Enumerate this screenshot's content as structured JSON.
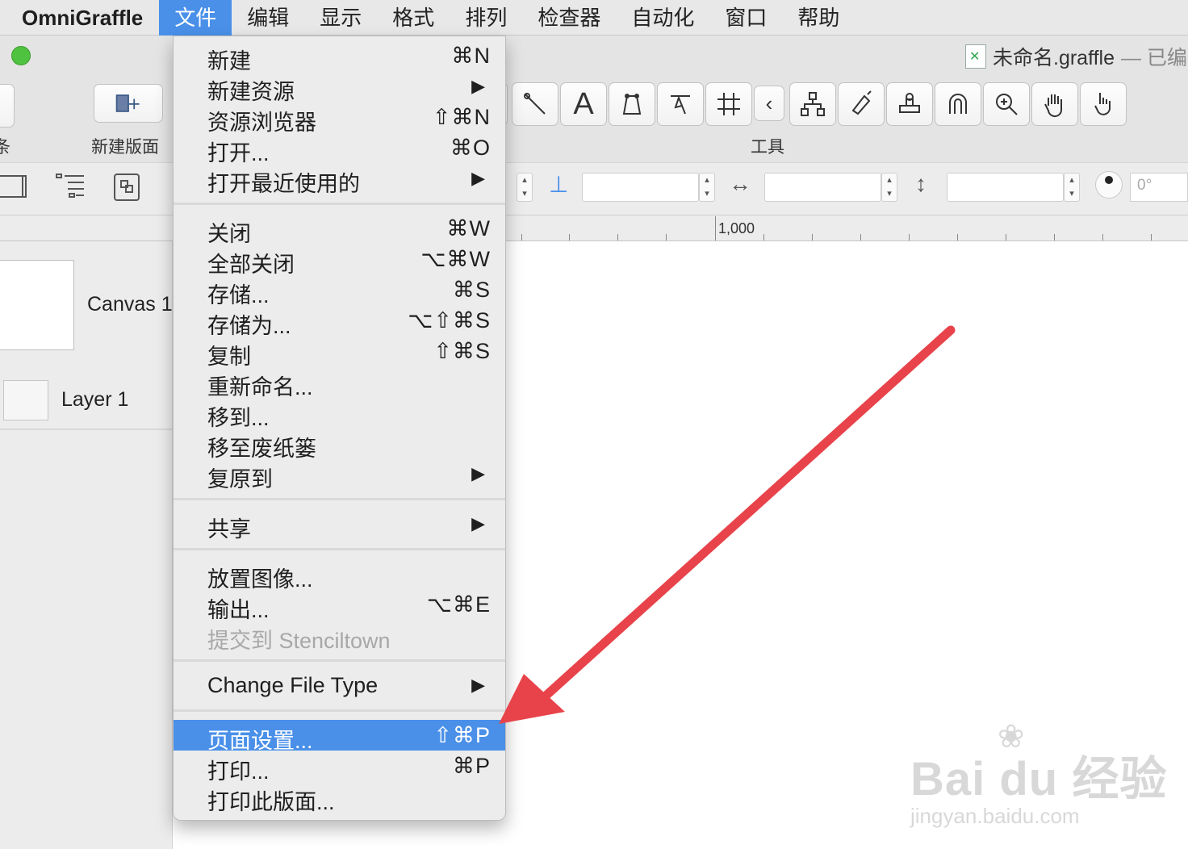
{
  "menubar": {
    "app_name": "OmniGraffle",
    "items": [
      "文件",
      "编辑",
      "显示",
      "格式",
      "排列",
      "检查器",
      "自动化",
      "窗口",
      "帮助"
    ]
  },
  "window": {
    "title": "未命名.graffle",
    "title_suffix": "— 已编",
    "toolbar": {
      "left_partial_label": "条",
      "new_canvas_label": "新建版面",
      "tools_label": "工具"
    },
    "inspector": {
      "angle_value": "0°"
    },
    "ruler": {
      "label": "1,000"
    },
    "sidebar": {
      "canvas_name": "Canvas 1",
      "layer_name": "Layer 1"
    }
  },
  "file_menu": {
    "groups": [
      [
        {
          "label": "新建",
          "shortcut": "⌘N"
        },
        {
          "label": "新建资源",
          "submenu": true
        },
        {
          "label": "资源浏览器",
          "shortcut": "⇧⌘N"
        },
        {
          "label": "打开...",
          "shortcut": "⌘O"
        },
        {
          "label": "打开最近使用的",
          "submenu": true
        }
      ],
      [
        {
          "label": "关闭",
          "shortcut": "⌘W"
        },
        {
          "label": "全部关闭",
          "shortcut": "⌥⌘W"
        },
        {
          "label": "存储...",
          "shortcut": "⌘S"
        },
        {
          "label": "存储为...",
          "shortcut": "⌥⇧⌘S"
        },
        {
          "label": "复制",
          "shortcut": "⇧⌘S"
        },
        {
          "label": "重新命名..."
        },
        {
          "label": "移到..."
        },
        {
          "label": "移至废纸篓"
        },
        {
          "label": "复原到",
          "submenu": true
        }
      ],
      [
        {
          "label": "共享",
          "submenu": true
        }
      ],
      [
        {
          "label": "放置图像..."
        },
        {
          "label": "输出...",
          "shortcut": "⌥⌘E"
        },
        {
          "label": "提交到 Stenciltown",
          "disabled": true
        }
      ],
      [
        {
          "label": "Change File Type",
          "submenu": true
        }
      ],
      [
        {
          "label": "页面设置...",
          "shortcut": "⇧⌘P",
          "highlighted": true
        },
        {
          "label": "打印...",
          "shortcut": "⌘P"
        },
        {
          "label": "打印此版面..."
        }
      ]
    ]
  },
  "tools": [
    "line-tool",
    "text-tool",
    "bezier-tool",
    "point-edit-tool",
    "grid-tool",
    "collapse",
    "diagram-tool",
    "style-brush",
    "stamp-tool",
    "magnet-tool",
    "zoom-tool",
    "hand-tool",
    "browse-tool"
  ],
  "watermark": {
    "main": "Bai du 经验",
    "sub": "jingyan.baidu.com"
  },
  "colors": {
    "highlight": "#4a90e9",
    "arrow": "#e8434a",
    "traffic_green": "#4fc23f"
  }
}
